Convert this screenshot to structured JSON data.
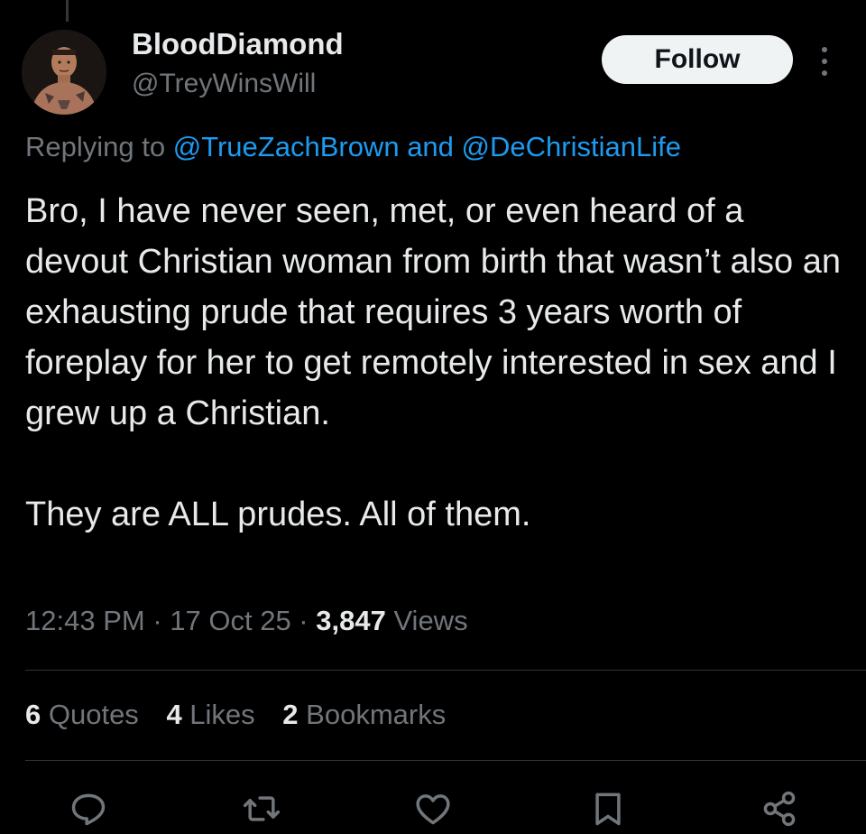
{
  "author": {
    "display_name": "BloodDiamond",
    "handle": "@TreyWinsWill"
  },
  "follow_label": "Follow",
  "reply": {
    "prefix": "Replying to ",
    "mention_1": "@TrueZachBrown",
    "conjunction": " and ",
    "mention_2": "@DeChristianLife"
  },
  "tweet": {
    "paragraph_1": "Bro, I have never seen, met, or even heard of a devout Christian woman from birth that wasn’t also an exhausting prude that requires 3 years worth of foreplay for her to get remotely interested in sex and I grew up a Christian.",
    "paragraph_2": "They are ALL prudes. All of them."
  },
  "meta": {
    "time": "12:43 PM",
    "separator": " · ",
    "date": "17 Oct 25",
    "views_count": "3,847",
    "views_label": " Views"
  },
  "stats": [
    {
      "count": "6",
      "label": " Quotes"
    },
    {
      "count": "4",
      "label": " Likes"
    },
    {
      "count": "2",
      "label": " Bookmarks"
    }
  ],
  "actions": [
    "reply-icon",
    "retweet-icon",
    "like-icon",
    "bookmark-icon",
    "share-icon"
  ],
  "colors": {
    "background": "#000000",
    "text_primary": "#e7e9ea",
    "text_secondary": "#71767b",
    "link": "#1d9bf0",
    "follow_button_bg": "#eff3f4",
    "divider": "#2f3336"
  }
}
